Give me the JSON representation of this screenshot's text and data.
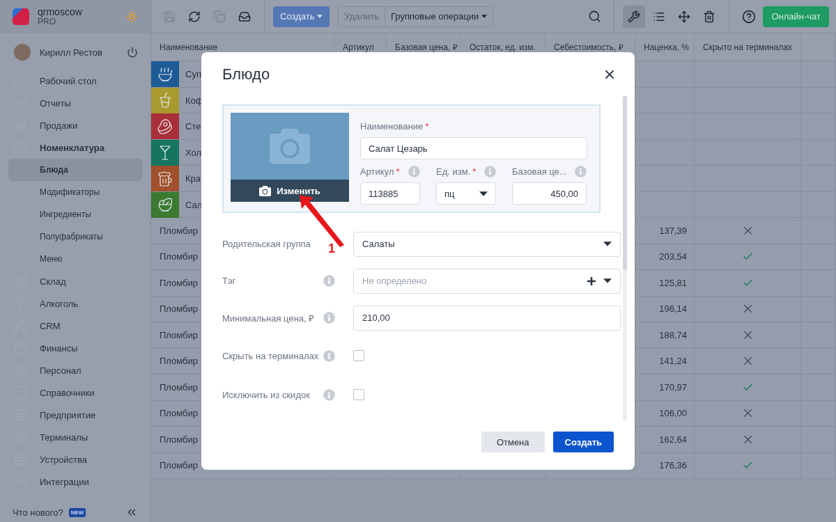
{
  "sidebar": {
    "brand": {
      "name": "qrmoscow",
      "plan": "PRO"
    },
    "user": {
      "name": "Кирилл Рестов"
    },
    "nav": [
      {
        "label": "Рабочий стол",
        "selected": false,
        "expanded": false
      },
      {
        "label": "Отчеты",
        "selected": false,
        "expanded": false
      },
      {
        "label": "Продажи",
        "selected": false,
        "expanded": false
      },
      {
        "label": "Номенклатура",
        "selected": false,
        "expanded": true,
        "children": [
          {
            "label": "Блюда",
            "selected": true
          },
          {
            "label": "Модификаторы",
            "selected": false
          },
          {
            "label": "Ингредиенты",
            "selected": false
          },
          {
            "label": "Полуфабрикаты",
            "selected": false
          },
          {
            "label": "Меню",
            "selected": false
          }
        ]
      },
      {
        "label": "Склад",
        "selected": false,
        "expanded": false
      },
      {
        "label": "Алкоголь",
        "selected": false,
        "expanded": false
      },
      {
        "label": "CRM",
        "selected": false,
        "expanded": false
      },
      {
        "label": "Финансы",
        "selected": false,
        "expanded": false
      },
      {
        "label": "Персонал",
        "selected": false,
        "expanded": false
      },
      {
        "label": "Справочники",
        "selected": false,
        "expanded": false
      },
      {
        "label": "Предприятие",
        "selected": false,
        "expanded": false
      },
      {
        "label": "Терминалы",
        "selected": false,
        "expanded": false
      },
      {
        "label": "Устройства",
        "selected": false,
        "expanded": false
      },
      {
        "label": "Интеграции",
        "selected": false,
        "expanded": false
      }
    ],
    "whats_new": {
      "label": "Что нового?",
      "badge": "NEW"
    }
  },
  "toolbar": {
    "file_actions": [
      {
        "disabled": true
      },
      {
        "disabled": false
      },
      {
        "disabled": true
      },
      {
        "disabled": false
      }
    ],
    "create": "Создать",
    "delete": {
      "label": "Удалить",
      "disabled": true
    },
    "group_ops": "Групповые операции",
    "view_tools": [
      {
        "selected": true
      },
      {
        "selected": false
      },
      {
        "selected": false
      },
      {
        "selected": false
      }
    ],
    "chat": "Онлайн-чат"
  },
  "table": {
    "columns": [
      "Наименование",
      "Артикул",
      "Базовая цена, ₽",
      "Остаток, ед. изм.",
      "Себестоимость, ₽",
      "Наценка, %",
      "Скрыто на терминалах"
    ],
    "rows": [
      {
        "kind": "group",
        "name": "Суп",
        "color": "#1d5b95"
      },
      {
        "kind": "group",
        "name": "Коф",
        "color": "#a99a30"
      },
      {
        "kind": "group",
        "name": "Сте",
        "color": "#a8303a"
      },
      {
        "kind": "group",
        "name": "Хол",
        "color": "#157560"
      },
      {
        "kind": "group",
        "name": "Кра",
        "color": "#a0502a"
      },
      {
        "kind": "group",
        "name": "Сал",
        "color": "#3b7a30"
      },
      {
        "kind": "item",
        "name": "Пломбир",
        "markup": "137,39",
        "hidden": false
      },
      {
        "kind": "item",
        "name": "Пломбир",
        "markup": "203,54",
        "hidden": true
      },
      {
        "kind": "item",
        "name": "Пломбир",
        "markup": "125,81",
        "hidden": true
      },
      {
        "kind": "item",
        "name": "Пломбир",
        "markup": "196,14",
        "hidden": false
      },
      {
        "kind": "item",
        "name": "Пломбир",
        "markup": "188,74",
        "hidden": false
      },
      {
        "kind": "item",
        "name": "Пломбир",
        "markup": "141,24",
        "hidden": false
      },
      {
        "kind": "item",
        "name": "Пломбир",
        "markup": "170,97",
        "hidden": true
      },
      {
        "kind": "item",
        "name": "Пломбир",
        "markup": "106,00",
        "hidden": false
      },
      {
        "kind": "item",
        "name": "Пломбир",
        "markup": "162,64",
        "hidden": false
      },
      {
        "kind": "item",
        "name": "Пломбир",
        "markup": "176,36",
        "hidden": true
      }
    ]
  },
  "modal": {
    "title": "Блюдо",
    "photo": {
      "action": "Изменить"
    },
    "required_mark": "*",
    "fields": [
      {
        "label": "Наименование",
        "required": true,
        "info": false,
        "value": "Салат Цезарь"
      },
      {
        "label": "Артикул",
        "required": true,
        "info": true,
        "value": "113885"
      },
      {
        "label": "Ед. изм.",
        "required": true,
        "info": true,
        "value": "пц",
        "kind": "select"
      },
      {
        "label": "Базовая це...",
        "required": false,
        "info": true,
        "value": "450,00",
        "kind": "number"
      }
    ],
    "rows": [
      {
        "kind": "select",
        "label": "Родительская группа",
        "info": false,
        "value": "Салаты"
      },
      {
        "kind": "tag",
        "label": "Тэг",
        "info": true,
        "placeholder": "Не определено"
      },
      {
        "kind": "input",
        "label": "Минимальная цена, ₽",
        "info": true,
        "value": "210,00"
      },
      {
        "kind": "checkbox",
        "label": "Скрыть на терминалах",
        "info": true,
        "checked": false
      },
      {
        "kind": "checkbox",
        "label": "Исключить из скидок",
        "info": true,
        "checked": false
      }
    ],
    "cancel": "Отмена",
    "submit": "Создать"
  },
  "annotation": {
    "number": "1"
  }
}
